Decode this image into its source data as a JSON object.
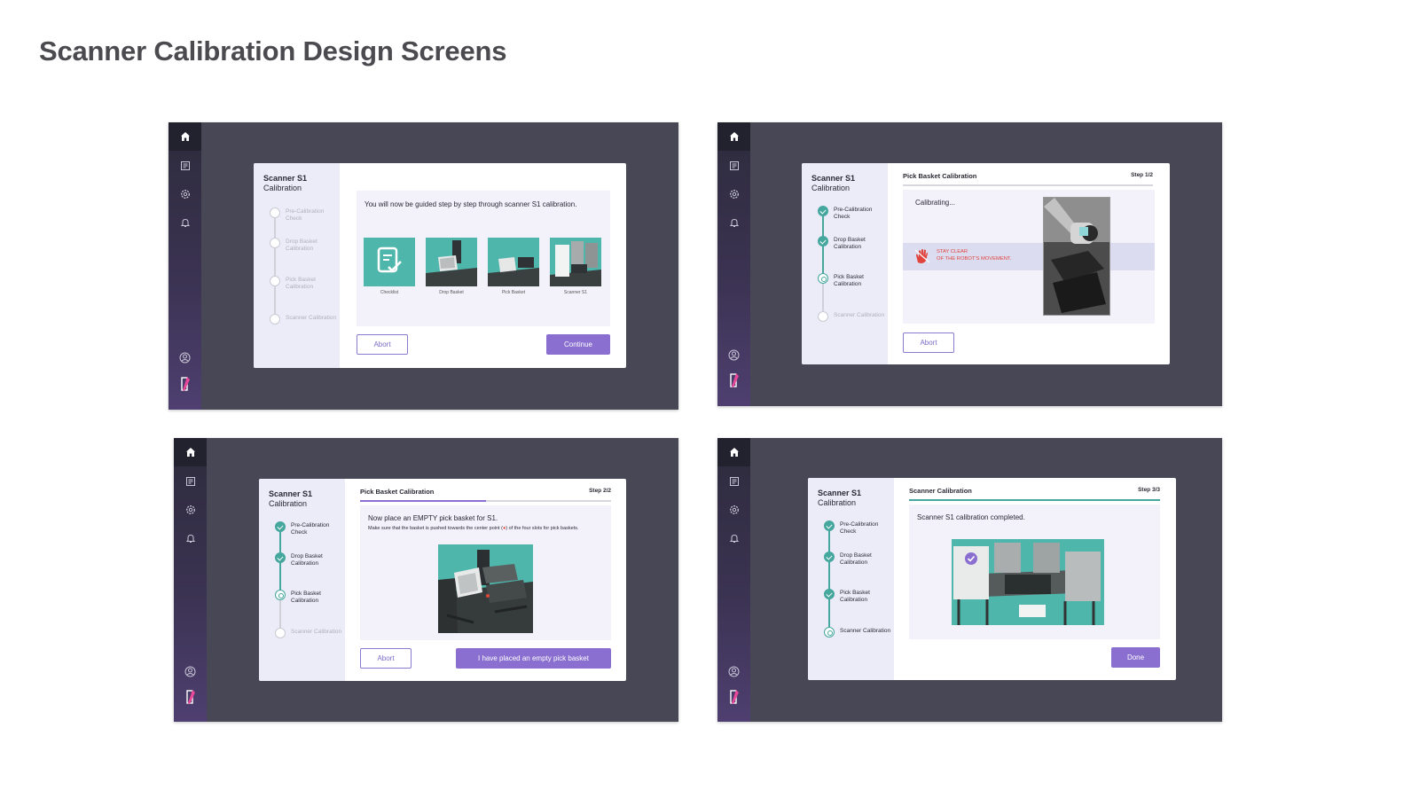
{
  "page": {
    "title": "Scanner Calibration Design Screens"
  },
  "colors": {
    "accent": "#8a6fd0",
    "teal": "#45a79e",
    "frame": "#474755",
    "rail_top": "#2d2b3c",
    "rail_bottom": "#4e3f70",
    "warning": "#e0443c"
  },
  "nav": {
    "icons": [
      "home-icon",
      "clipboard-icon",
      "gear-icon",
      "bell-icon",
      "user-icon",
      "brand-logo-icon"
    ]
  },
  "dialog": {
    "title": "Scanner S1",
    "subtitle": "Calibration"
  },
  "steps": [
    {
      "label": "Pre-Calibration Check"
    },
    {
      "label": "Drop Basket Calibration"
    },
    {
      "label": "Pick Basket Calibration"
    },
    {
      "label": "Scanner Calibration"
    }
  ],
  "screen1": {
    "intro": "You will now be guided step by step through scanner S1 calibration.",
    "thumbs": [
      "Checklist",
      "Drop Basket",
      "Pick Basket",
      "Scanner S1"
    ],
    "abort": "Abort",
    "continue": "Continue"
  },
  "screen2": {
    "header": "Pick Basket Calibration",
    "step": "Step 1/2",
    "progress": 0.5,
    "status": "Calibrating...",
    "warning_line1": "STAY CLEAR",
    "warning_line2": "OF THE ROBOT'S MOVEMENT.",
    "abort": "Abort"
  },
  "screen3": {
    "header": "Pick Basket Calibration",
    "step": "Step 2/2",
    "progress": 0.5,
    "instruction": "Now place an EMPTY pick basket for S1.",
    "detail_a": "Make sure that the basket is pushed towards the center point (",
    "detail_b": ") of the four slots for pick baskets.",
    "abort": "Abort",
    "confirm": "I have placed an empty pick basket"
  },
  "screen4": {
    "header": "Scanner Calibration",
    "step": "Step 3/3",
    "progress": 1,
    "message": "Scanner S1 calibration completed.",
    "done": "Done"
  }
}
